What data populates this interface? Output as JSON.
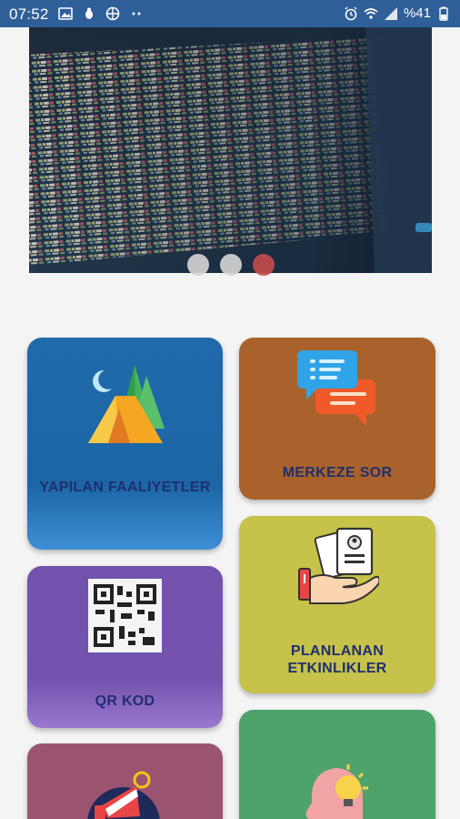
{
  "status_bar": {
    "time": "07:52",
    "battery": "%41",
    "left_icons": [
      "image-icon",
      "bug-icon",
      "globe-icon",
      "more-icon"
    ],
    "right_icons": [
      "alarm-icon",
      "wifi-icon",
      "signal-icon",
      "battery-icon"
    ]
  },
  "carousel": {
    "page_count": 3,
    "active_index": 2,
    "image": "code-screen-image"
  },
  "menu": {
    "activities": {
      "label": "YAPILAN FAALIYETLER",
      "icon": "tent-icon"
    },
    "ask_center": {
      "label": "MERKEZE SOR",
      "icon": "chat-bubbles-icon"
    },
    "planned": {
      "label": "PLANLANAN ETKINLIKLER",
      "icon": "hand-cards-icon"
    },
    "qr": {
      "label": "QR KOD",
      "icon": "qr-code-icon"
    },
    "announcements": {
      "icon": "megaphone-icon"
    },
    "ideas": {
      "icon": "head-lightbulb-icon"
    }
  },
  "colors": {
    "status_bar": "#2f5f99",
    "card_activities": "#1c66a6",
    "card_ask_center": "#a9622c",
    "card_planned": "#c6c24a",
    "card_qr": "#7353ae",
    "card_announcements": "#9a5470",
    "card_ideas": "#4ea36a",
    "label_text": "#1f2f6e"
  }
}
